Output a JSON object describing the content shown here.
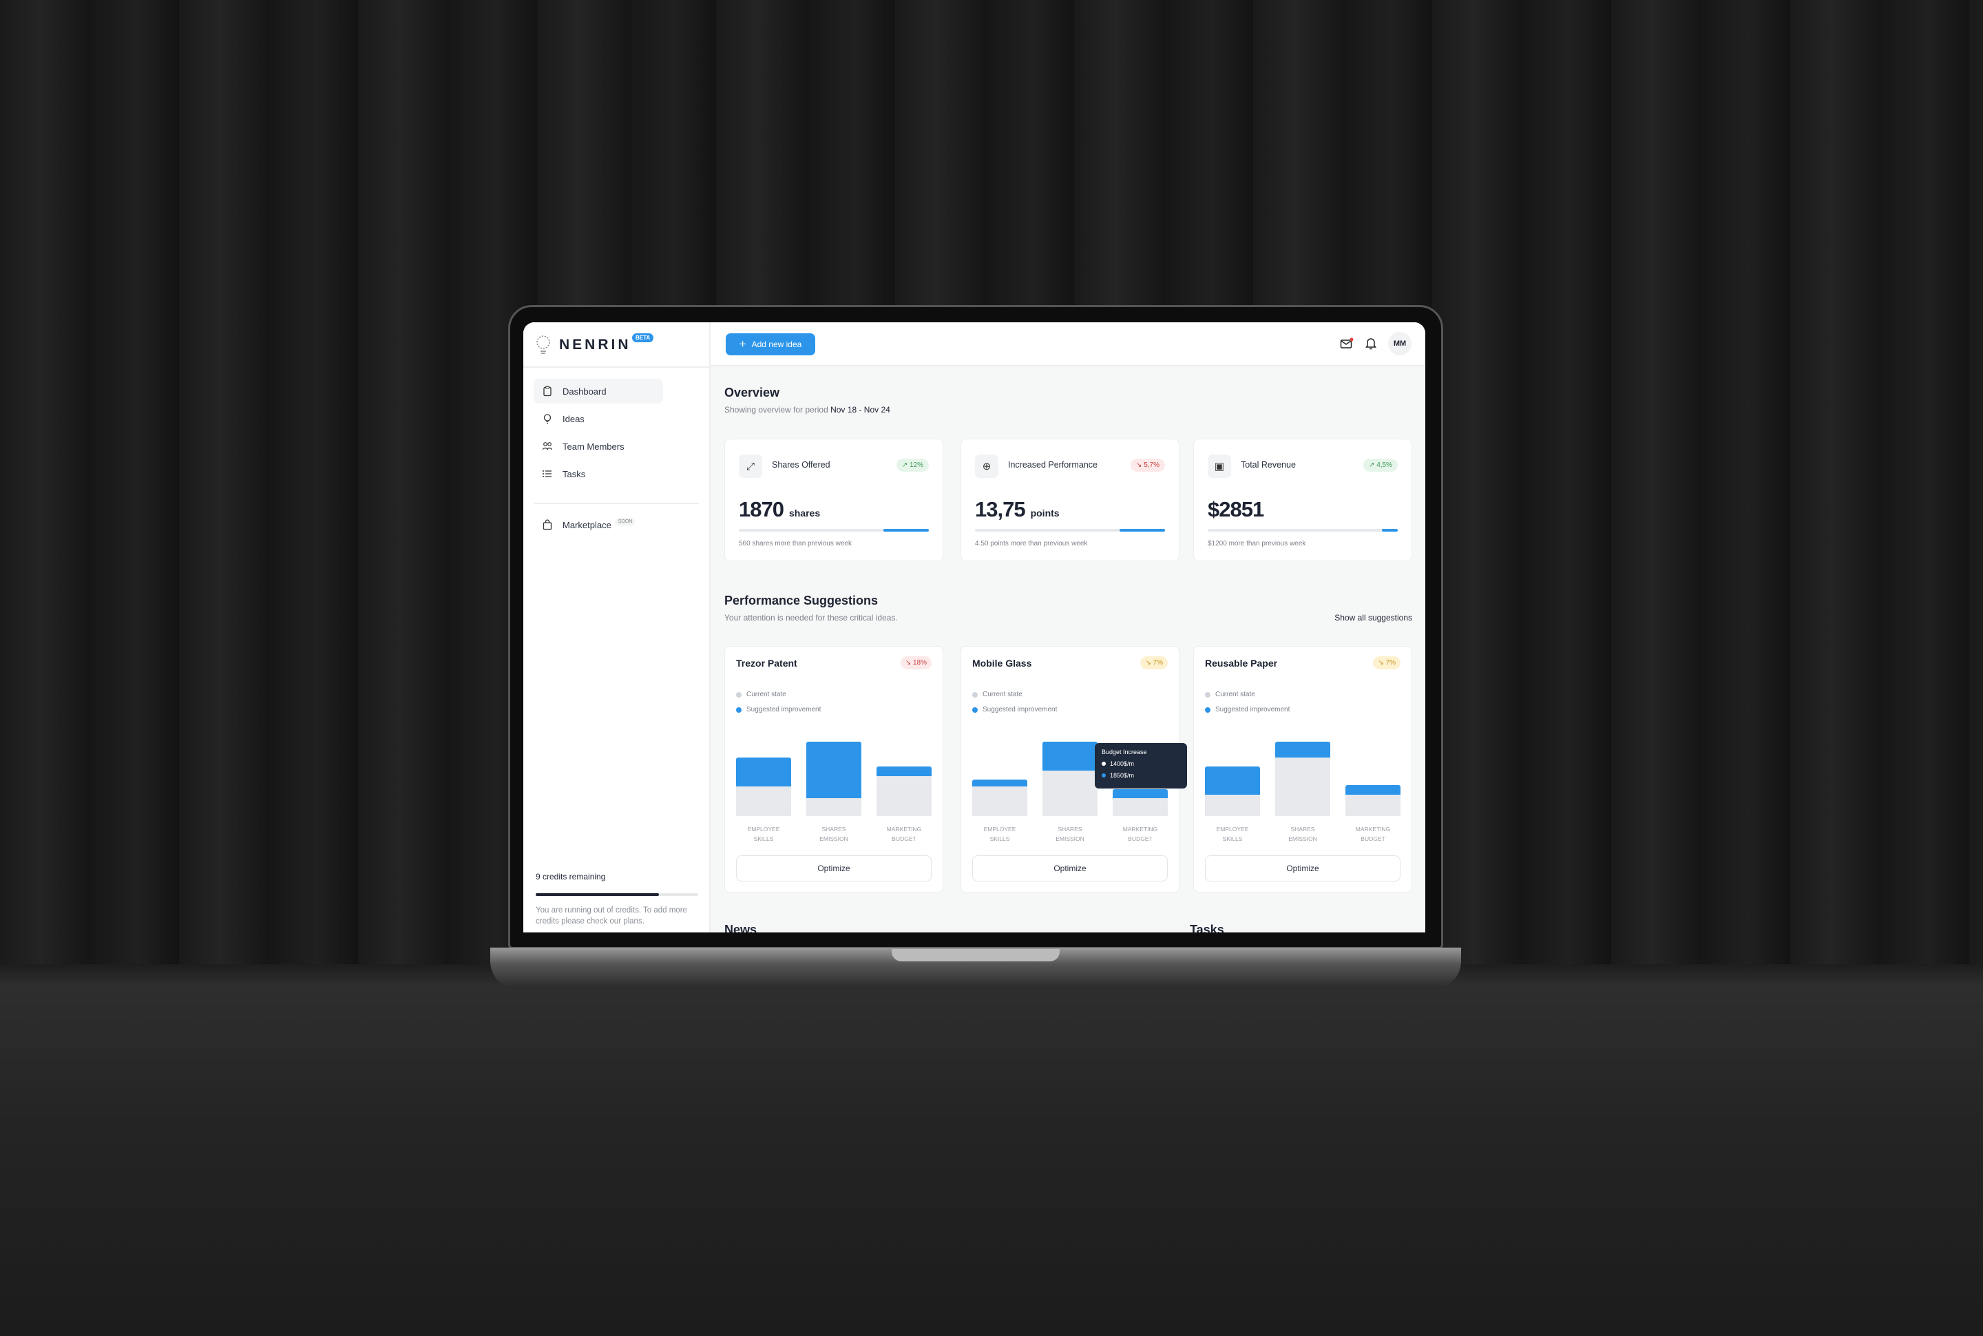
{
  "brand": {
    "name": "NENRIN",
    "badge": "BETA"
  },
  "sidebar": {
    "items": [
      {
        "label": "Dashboard",
        "icon": "clipboard-icon",
        "active": true
      },
      {
        "label": "Ideas",
        "icon": "lightbulb-icon"
      },
      {
        "label": "Team Members",
        "icon": "users-icon"
      },
      {
        "label": "Tasks",
        "icon": "list-icon"
      }
    ],
    "marketplace": {
      "label": "Marketplace",
      "badge": "SOON",
      "icon": "shopping-bag-icon"
    },
    "credits": {
      "label": "9 credits remaining",
      "fraction": 0.76,
      "note": "You are running out of credits. To add more credits please check our plans."
    }
  },
  "header": {
    "add_button": "Add new idea",
    "avatar": "MM",
    "mail_unread": true
  },
  "overview": {
    "title": "Overview",
    "subtitle": "Showing overview for period",
    "period": "Nov 18 - Nov 24",
    "stats": [
      {
        "label": "Shares Offered",
        "icon": "expand-icon",
        "badge": "↗ 12%",
        "trend": "up",
        "value": "1870",
        "unit": "shares",
        "progress": 0.24,
        "footer": "560 shares more than previous week"
      },
      {
        "label": "Increased Performance",
        "icon": "arrow-up-circle-icon",
        "badge": "↘ 5,7%",
        "trend": "down",
        "value": "13,75",
        "unit": "points",
        "progress": 0.24,
        "footer": "4.50 points more than previous week"
      },
      {
        "label": "Total Revenue",
        "icon": "banknote-icon",
        "badge": "↗ 4,5%",
        "trend": "up",
        "value": "$2851",
        "unit": "",
        "progress": 0.085,
        "footer": "$1200 more than previous week"
      }
    ]
  },
  "suggestions": {
    "title": "Performance Suggestions",
    "subtitle": "Your attention is needed for these critical ideas.",
    "show_all": "Show all suggestions",
    "legend": {
      "current": "Current state",
      "suggested": "Suggested improvement"
    },
    "optimize_label": "Optimize",
    "colors": {
      "current": "#e7e9ec",
      "suggested": "#2c95ea"
    },
    "categories": [
      [
        "EMPLOYEE",
        "SKILLS"
      ],
      [
        "SHARES",
        "EMISSION"
      ],
      [
        "MARKETING",
        "BUDGET"
      ]
    ],
    "cards": [
      {
        "title": "Trezor Patent",
        "badge": "↘ 18%",
        "trend": "down",
        "current": [
          40,
          24,
          54
        ],
        "suggested": [
          79,
          100,
          67
        ]
      },
      {
        "title": "Mobile Glass",
        "badge": "↘ 7%",
        "trend": "warn",
        "current": [
          40,
          61,
          24
        ],
        "suggested": [
          49,
          100,
          36
        ]
      },
      {
        "title": "Reusable Paper",
        "badge": "↘ 7%",
        "trend": "warn",
        "current": [
          29,
          79,
          29
        ],
        "suggested": [
          67,
          100,
          42
        ]
      }
    ],
    "tooltip": {
      "title": "Budget Increase",
      "current": "1400$/m",
      "suggested": "1850$/m"
    }
  },
  "below": {
    "news": "News",
    "tasks": "Tasks"
  }
}
